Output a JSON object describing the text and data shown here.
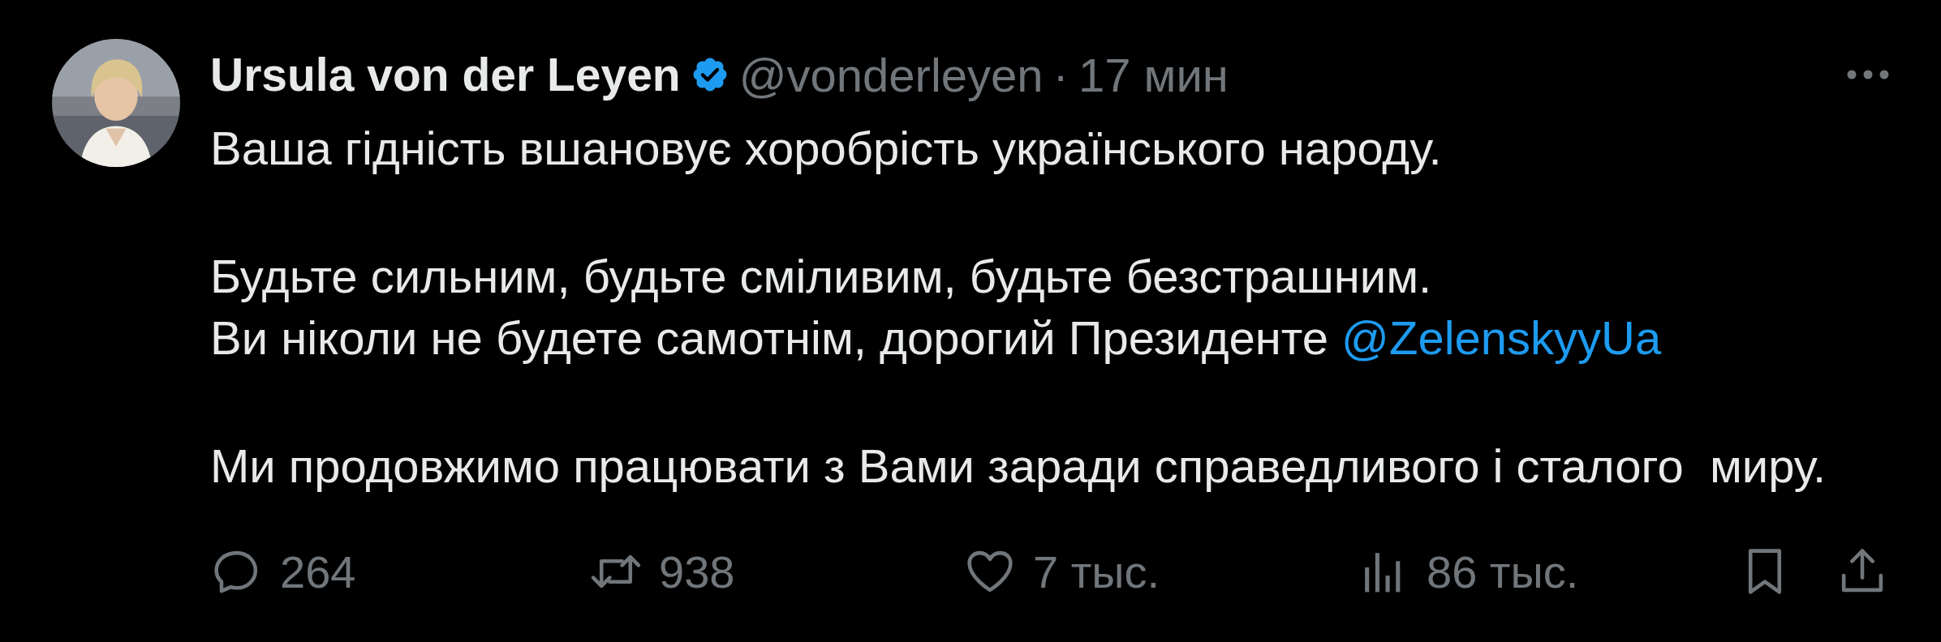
{
  "author": {
    "name": "Ursula von der Leyen",
    "verified": true,
    "handle": "@vonderleyen",
    "separator": "·",
    "time": "17 мин"
  },
  "paragraphs": [
    {
      "lines": [
        [
          {
            "kind": "text",
            "text": "Ваша гідність вшановує хоробрість українського народу."
          }
        ]
      ]
    },
    {
      "lines": [
        [
          {
            "kind": "text",
            "text": "Будьте сильним, будьте сміливим, будьте безстрашним."
          }
        ],
        [
          {
            "kind": "text",
            "text": "Ви ніколи не будете самотнім, дорогий Президенте "
          },
          {
            "kind": "mention",
            "text": "@ZelenskyyUa"
          }
        ]
      ]
    },
    {
      "lines": [
        [
          {
            "kind": "text",
            "text": "Ми продовжимо працювати з Вами заради справедливого і сталого  миру."
          }
        ]
      ]
    }
  ],
  "actions": [
    {
      "kind": "reply",
      "count": "264"
    },
    {
      "kind": "repost",
      "count": "938"
    },
    {
      "kind": "like",
      "count": "7 тыс."
    },
    {
      "kind": "views",
      "count": "86 тыс."
    },
    {
      "kind": "bookmark"
    },
    {
      "kind": "share"
    }
  ]
}
